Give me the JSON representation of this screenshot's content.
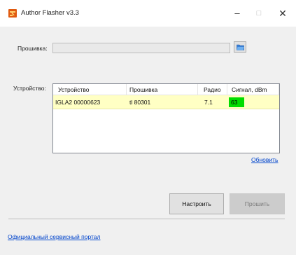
{
  "window": {
    "title": "Author Flasher v3.3",
    "controls": {
      "minimize": "–",
      "maximize": "□",
      "close": "✕"
    }
  },
  "firmware": {
    "label": "Прошивка:",
    "value": ""
  },
  "device": {
    "label": "Устройство:",
    "columns": [
      "Устройство",
      "Прошивка",
      "Радио",
      "Сигнал, dBm"
    ],
    "rows": [
      {
        "device": "IGLA2 00000623",
        "firmware": "tl 80301",
        "radio": "7.1",
        "signal": "63"
      }
    ],
    "signal_color": "#00dd00",
    "row_highlight_color": "#ffffc4"
  },
  "links": {
    "refresh": "Обновить",
    "portal": "Официальный сервисный портал"
  },
  "buttons": {
    "configure": "Настроить",
    "flash": "Прошить"
  }
}
